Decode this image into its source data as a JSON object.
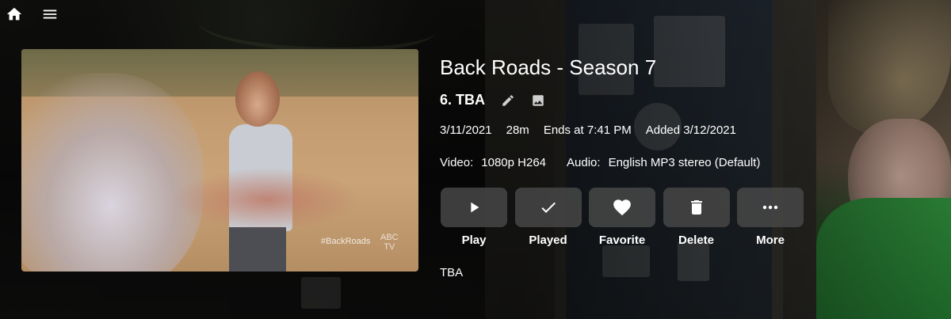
{
  "header": {
    "home_icon": "home-icon",
    "menu_icon": "menu-icon"
  },
  "thumbnail": {
    "hashtag": "#BackRoads",
    "logo_top": "ABC",
    "logo_bottom": "TV"
  },
  "series_title": "Back Roads - Season 7",
  "episode": {
    "title": "6. TBA",
    "edit_icon": "pencil-icon",
    "image_icon": "image-icon"
  },
  "meta": {
    "air_date": "3/11/2021",
    "runtime": "28m",
    "ends_at": "Ends at 7:41 PM",
    "added": "Added 3/12/2021"
  },
  "media": {
    "video_label": "Video:",
    "video_value": "1080p H264",
    "audio_label": "Audio:",
    "audio_value": "English MP3 stereo (Default)"
  },
  "actions": [
    {
      "label": "Play",
      "icon": "play-icon"
    },
    {
      "label": "Played",
      "icon": "check-icon"
    },
    {
      "label": "Favorite",
      "icon": "heart-icon"
    },
    {
      "label": "Delete",
      "icon": "trash-icon"
    },
    {
      "label": "More",
      "icon": "more-icon"
    }
  ],
  "overview": "TBA"
}
